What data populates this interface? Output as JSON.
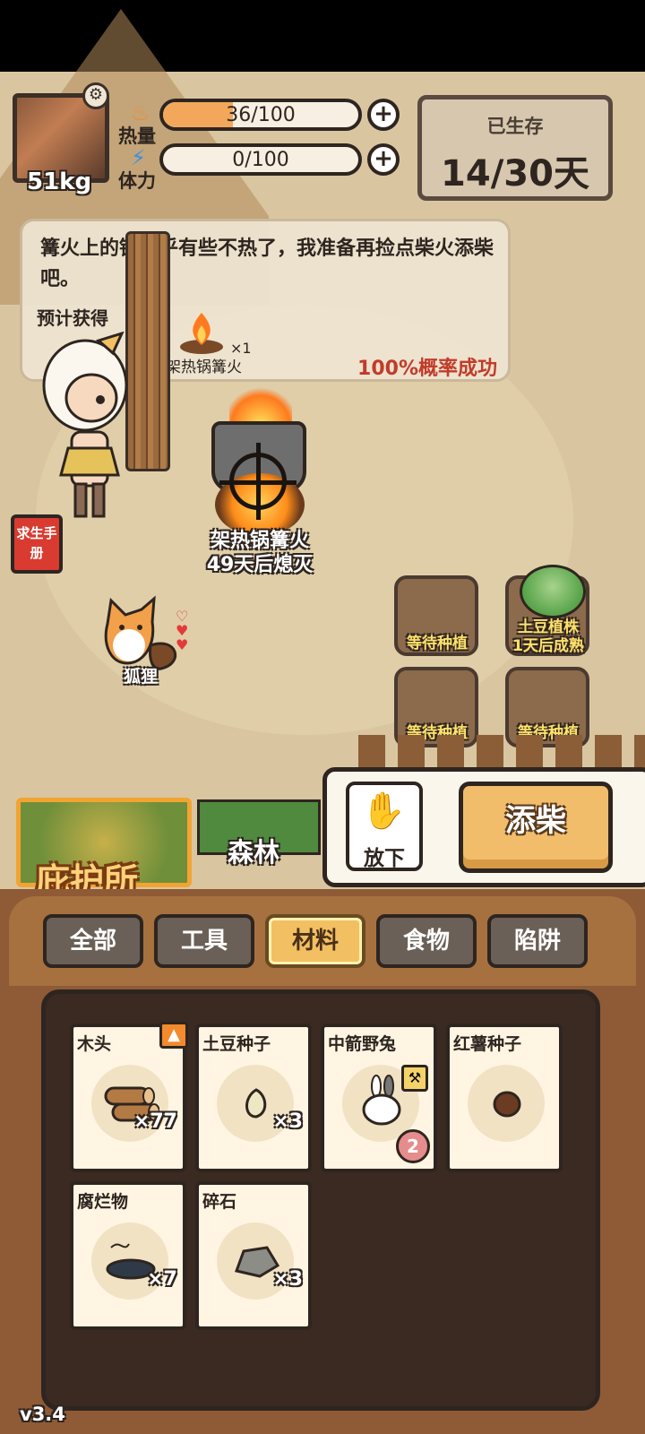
{
  "header": {
    "weight": "51kg",
    "calories": {
      "label": "热量",
      "value": "36/100",
      "level": 0.36
    },
    "stamina": {
      "label": "体力",
      "value": "0/100",
      "level": 0.0
    },
    "survival": {
      "label": "已生存",
      "value": "14/30天"
    }
  },
  "dialog": {
    "message": "篝火上的锅似乎有些不热了，我准备再捡点柴火添柴吧。",
    "expected_label": "预计获得",
    "reward_name": "架热锅篝火",
    "reward_qty": "×1",
    "chance": "100%概率成功"
  },
  "scene": {
    "campfire": {
      "name": "架热锅篝火",
      "status": "49天后熄灭"
    },
    "manual": "求生手册",
    "pet": "狐狸",
    "plots": [
      {
        "label": "等待种植"
      },
      {
        "label": "土豆植株\n1天后成熟"
      },
      {
        "label": "等待种植"
      },
      {
        "label": "等待种植"
      }
    ]
  },
  "locations": {
    "current": "庇护所",
    "other": "森林"
  },
  "actions": {
    "drop": "放下",
    "add_wood": "添柴"
  },
  "tabs": [
    {
      "label": "全部",
      "active": false
    },
    {
      "label": "工具",
      "active": false
    },
    {
      "label": "材料",
      "active": true
    },
    {
      "label": "食物",
      "active": false
    },
    {
      "label": "陷阱",
      "active": false
    }
  ],
  "inventory": [
    {
      "name": "木头",
      "qty": "×77",
      "icon": "wood-icon",
      "badge": "upgrade-arrow-icon"
    },
    {
      "name": "土豆种子",
      "qty": "×3",
      "icon": "potato-seed-icon"
    },
    {
      "name": "中箭野兔",
      "qty": "",
      "icon": "rabbit-icon",
      "badge": "tool-icon",
      "count": "2"
    },
    {
      "name": "红薯种子",
      "qty": "",
      "icon": "sweet-potato-seed-icon"
    },
    {
      "name": "腐烂物",
      "qty": "×7",
      "icon": "rotten-icon"
    },
    {
      "name": "碎石",
      "qty": "×3",
      "icon": "stone-icon"
    }
  ],
  "version": "v3.4",
  "colors": {
    "accent": "#f2a432",
    "calorie_bar": "#f2a75b",
    "chance": "#c23b2a",
    "plot_label": "#ffe16a"
  }
}
